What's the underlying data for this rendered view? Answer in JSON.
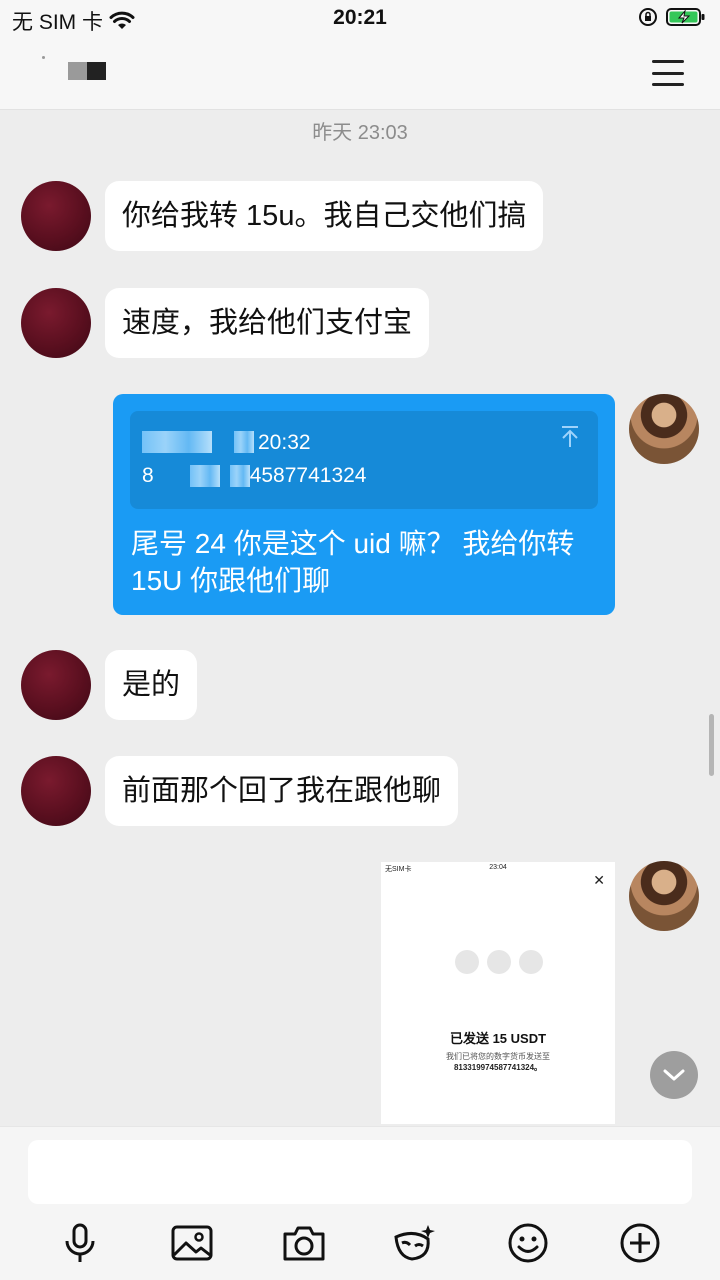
{
  "status_bar": {
    "carrier": "无 SIM 卡",
    "time": "20:21"
  },
  "chat": {
    "timestamp": "昨天 23:03"
  },
  "messages": {
    "m1": "你给我转 15u。我自己交他们搞",
    "m2": "速度，我给他们支付宝",
    "m3_quote_time": "20:32",
    "m3_quote_prefix": "8",
    "m3_quote_number": "4587741324",
    "m3_text": "尾号 24 你是这个 uid 嘛？ 我给你转 15U 你跟他们聊",
    "m4": "是的",
    "m5": "前面那个回了我在跟他聊"
  },
  "image_message": {
    "status_left": "无SIM卡",
    "status_time": "23:04",
    "close_glyph": "✕",
    "title": "已发送 15 USDT",
    "subtitle": "我们已将您的数字货币发送至",
    "address": "813319974587741324。"
  },
  "toolbar": {
    "icons": [
      "microphone-icon",
      "image-icon",
      "camera-icon",
      "sticker-icon",
      "smiley-icon",
      "plus-icon"
    ]
  },
  "colors": {
    "bubble_blue": "#1a9bf4",
    "background": "#ededed",
    "avatar_maroon": "#5a0f1f"
  }
}
